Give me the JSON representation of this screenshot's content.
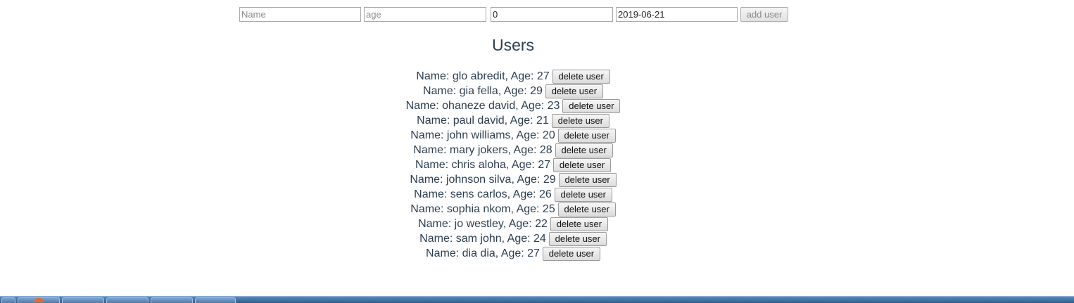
{
  "form": {
    "name_placeholder": "Name",
    "age_placeholder": "age",
    "number_value": "0",
    "date_value": "2019-06-21",
    "add_button_label": "add user"
  },
  "title": "Users",
  "delete_label": "delete user",
  "users": [
    {
      "text": "Name: glo abredit, Age: 27"
    },
    {
      "text": "Name: gia fella, Age: 29"
    },
    {
      "text": "Name: ohaneze david, Age: 23"
    },
    {
      "text": "Name: paul david, Age: 21"
    },
    {
      "text": "Name: john williams, Age: 20"
    },
    {
      "text": "Name: mary jokers, Age: 28"
    },
    {
      "text": "Name: chris aloha, Age: 27"
    },
    {
      "text": "Name: johnson silva, Age: 29"
    },
    {
      "text": "Name: sens carlos, Age: 26"
    },
    {
      "text": "Name: sophia nkom, Age: 25"
    },
    {
      "text": "Name: jo westley, Age: 22"
    },
    {
      "text": "Name: sam john, Age: 24"
    },
    {
      "text": "Name: dia dia, Age: 27"
    }
  ],
  "taskbar": {
    "icons": [
      "start-button-icon",
      "taskbar-app-icon",
      "taskbar-app-icon",
      "taskbar-app-icon",
      "taskbar-app-icon",
      "taskbar-app-icon"
    ]
  }
}
